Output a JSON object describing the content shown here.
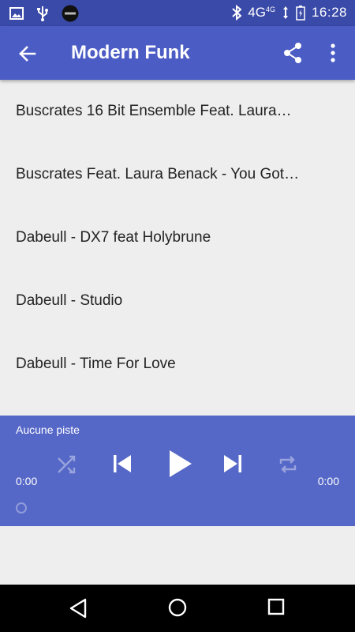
{
  "status_bar": {
    "clock": "16:28",
    "network": "4G",
    "network_small": "4G",
    "icons": [
      "image-icon",
      "usb-icon",
      "app-badge-icon",
      "bluetooth-icon",
      "signal-icon",
      "battery-icon"
    ]
  },
  "app_bar": {
    "title": "Modern Funk",
    "icons": [
      "back-arrow-icon",
      "share-icon",
      "more-vert-icon"
    ]
  },
  "tracks": [
    "Buscrates 16 Bit Ensemble Feat. Laura…",
    "Buscrates Feat. Laura Benack - You Got…",
    "Dabeull - DX7 feat Holybrune",
    "Dabeull - Studio",
    "Dabeull - Time For Love"
  ],
  "player": {
    "track": "Aucune piste",
    "time_elapsed": "0:00",
    "time_total": "0:00",
    "icons": [
      "shuffle-icon",
      "skip-previous-icon",
      "play-icon",
      "skip-next-icon",
      "repeat-icon"
    ]
  },
  "colors": {
    "status_bar": "#3a4aa8",
    "app_bar": "#4b5cc4",
    "player": "#5567c7",
    "background": "#eeeeee"
  }
}
